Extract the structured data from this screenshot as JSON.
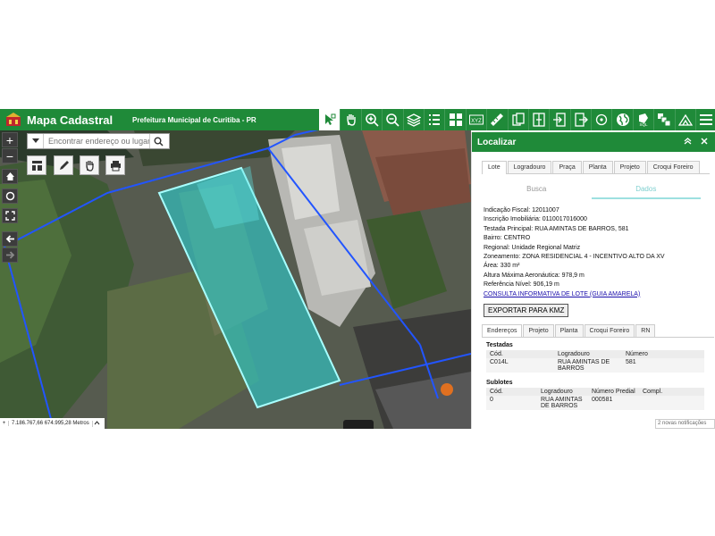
{
  "header": {
    "title": "Mapa Cadastral",
    "subtitle": "Prefeitura Municipal de Curitiba - PR"
  },
  "toolbar": {
    "icons": [
      "identify-icon",
      "pan-hand-icon",
      "zoom-in-icon",
      "zoom-out-icon",
      "layers-icon",
      "list-icon",
      "grid-icon",
      "xyz-icon",
      "measure-icon",
      "documents-icon",
      "split-icon",
      "import-icon",
      "export-icon",
      "target-icon",
      "globe-icon",
      "sql-icon",
      "layers-stack-icon",
      "area-icon",
      "menu-icon"
    ],
    "xyz_label": "XYZ",
    "sql_label": "SQL"
  },
  "map": {
    "search_placeholder": "Encontrar endereço ou lugar",
    "coords": "7.186.767,66 674.995,28 Metros"
  },
  "panel": {
    "title": "Localizar",
    "tabs": [
      "Lote",
      "Logradouro",
      "Praça",
      "Planta",
      "Projeto",
      "Croqui Foreiro"
    ],
    "subtabs": [
      "Busca",
      "Dados"
    ],
    "info": {
      "indicacao_fiscal_label": "Indicação Fiscal:",
      "indicacao_fiscal": "12011007",
      "inscricao_label": "Inscrição Imobiliária:",
      "inscricao": "0110017016000",
      "testada_label": "Testada Principal:",
      "testada": "RUA AMINTAS DE BARROS, 581",
      "bairro_label": "Bairro:",
      "bairro": "CENTRO",
      "regional_label": "Regional:",
      "regional": "Unidade Regional Matriz",
      "zoneamento_label": "Zoneamento:",
      "zoneamento": "ZONA RESIDENCIAL 4 - INCENTIVO ALTO DA XV",
      "area_label": "Área:",
      "area": "330 m²",
      "altura_label": "Altura Máxima Aeronáutica:",
      "altura": "978,9 m",
      "referencia_label": "Referência Nível:",
      "referencia": "906,19 m",
      "consulta_link": "CONSULTA INFORMATIVA DE LOTE (GUIA AMARELA)"
    },
    "export_button": "EXPORTAR PARA KMZ",
    "detail_tabs": [
      "Endereços",
      "Projeto",
      "Planta",
      "Croqui Foreiro",
      "RN"
    ],
    "testadas": {
      "title": "Testadas",
      "headers": [
        "Cód.",
        "Logradouro",
        "Número"
      ],
      "rows": [
        [
          "C014L",
          "RUA AMINTAS DE BARROS",
          "581"
        ]
      ]
    },
    "sublotes": {
      "title": "Sublotes",
      "headers": [
        "Cód.",
        "Logradouro",
        "Número Predial",
        "Compl."
      ],
      "rows": [
        [
          "0",
          "RUA AMINTAS DE BARROS",
          "000581",
          ""
        ]
      ]
    }
  },
  "toast": "2 novas notificações",
  "colors": {
    "header_green": "#1f8a39",
    "parcel_fill": "#2ec7c7",
    "boundary_blue": "#2255ff"
  }
}
